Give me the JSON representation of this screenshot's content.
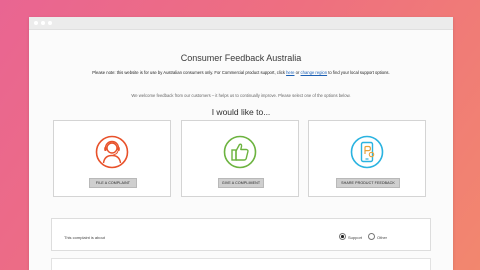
{
  "window": {
    "controls": [
      "window-dot",
      "window-dot",
      "window-dot"
    ]
  },
  "page": {
    "title": "Consumer Feedback Australia",
    "notice": {
      "prefix": "Please note: this website is for use by Australian consumers only. For Commercial product support, click ",
      "link1": "here",
      "middle": " or ",
      "link2": "change region",
      "suffix": " to find your local support options."
    },
    "welcome": "We welcome feedback from our customers – it helps us to continually improve. Please select one of the options below.",
    "heading": "I would like to..."
  },
  "colors": {
    "complaint_icon": "#e8512a",
    "compliment_icon": "#6cb33f",
    "product_feedback_icon": "#2ab3e0"
  },
  "options": [
    {
      "label": "FILE A COMPLAINT",
      "icon": "headset-agent-icon"
    },
    {
      "label": "GIVE A COMPLIMENT",
      "icon": "thumbs-up-icon"
    },
    {
      "label": "SHARE PRODUCT FEEDBACK",
      "icon": "phone-feedback-icon"
    }
  ],
  "form": {
    "label": "This complaint is about",
    "radios": [
      {
        "label": "Support",
        "checked": true
      },
      {
        "label": "Other",
        "checked": false
      }
    ]
  }
}
